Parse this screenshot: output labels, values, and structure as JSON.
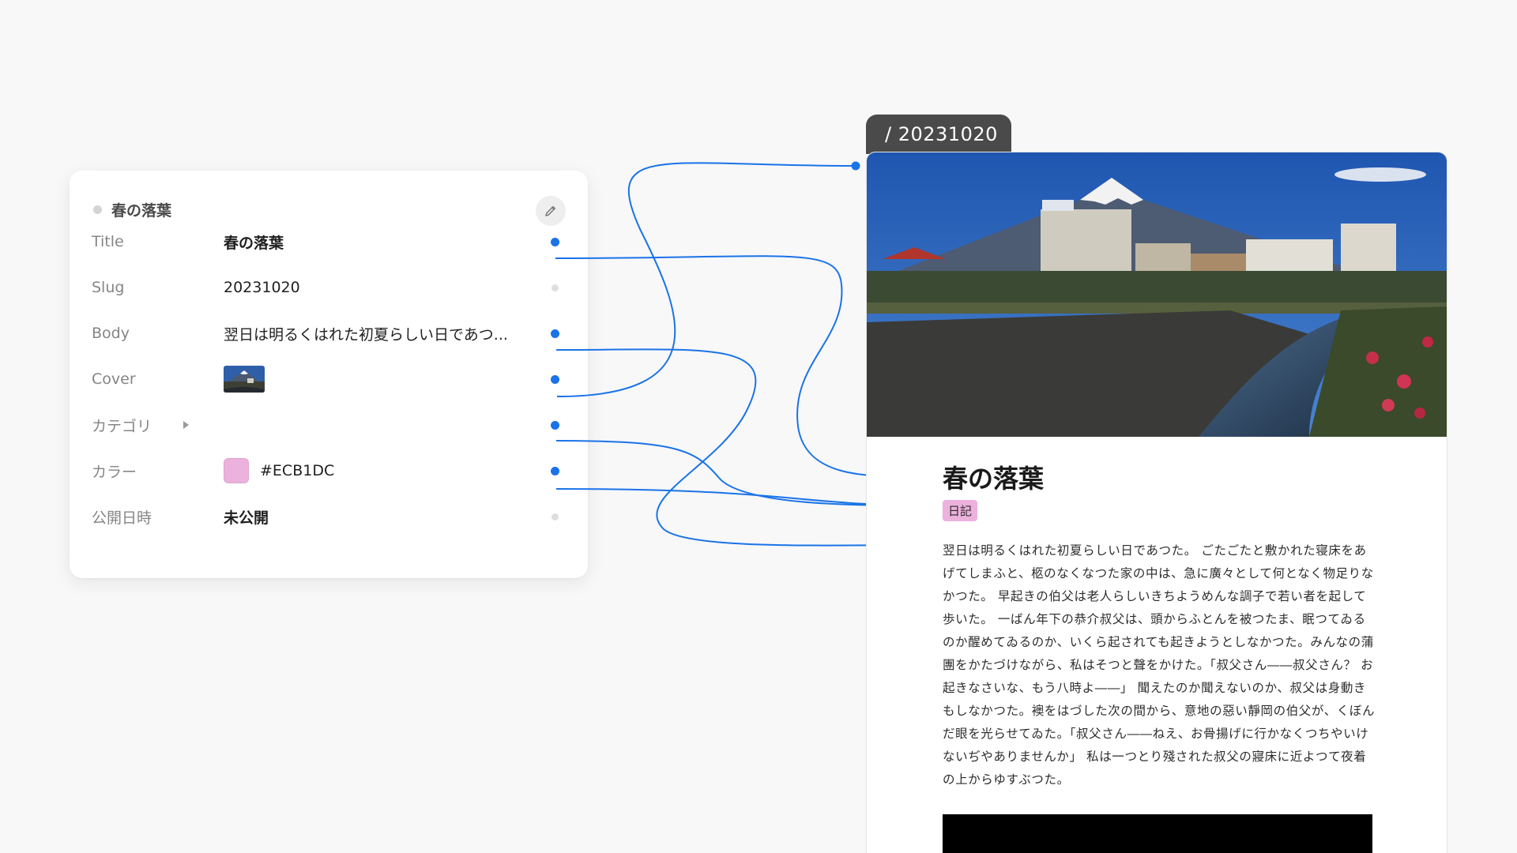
{
  "cms": {
    "header_title": "春の落葉",
    "fields": [
      {
        "label": "Title",
        "value": "春の落葉"
      },
      {
        "label": "Slug",
        "value": "20231020"
      },
      {
        "label": "Body",
        "value": "翌日は明るくはれた初夏らしい日であつ..."
      },
      {
        "label": "Cover",
        "value": ""
      },
      {
        "label": "カテゴリ",
        "value": ""
      },
      {
        "label": "カラー",
        "value": "#ECB1DC"
      },
      {
        "label": "公開日時",
        "value": "未公開"
      }
    ]
  },
  "preview": {
    "slug_tab": "/ 20231020",
    "title": "春の落葉",
    "category": "日記",
    "body": "翌日は明るくはれた初夏らしい日であつた。 ごたごたと敷かれた寝床をあげてしまふと、柩のなくなつた家の中は、急に廣々として何となく物足りなかつた。 早起きの伯父は老人らしいきちようめんな調子で若い者を起して歩いた。 一ばん年下の恭介叔父は、頭からふとんを被つたま、眠つてゐるのか醒めてゐるのか、いくら起されても起きようとしなかつた。みんなの蒲團をかたづけながら、私はそつと聲をかけた。「叔父さん――叔父さん？ お起きなさいな、もう八時よ――」 聞えたのか聞えないのか、叔父は身動きもしなかつた。襖をはづした次の間から、意地の惡い靜岡の伯父が、くぼんだ眼を光らせてゐた。「叔父さん――ねえ、お骨揚げに行かなくつちやいけないぢやありませんか」 私は一つとり殘された叔父の寢床に近よつて夜着の上からゆすぶつた。"
  },
  "colors": {
    "accent": "#1a73e8",
    "category_color": "#ECB1DC",
    "tab_bg": "#4a4a4a"
  },
  "icons": {
    "edit": "pencil-icon",
    "expand": "caret-right-icon",
    "status": "status-dot"
  }
}
